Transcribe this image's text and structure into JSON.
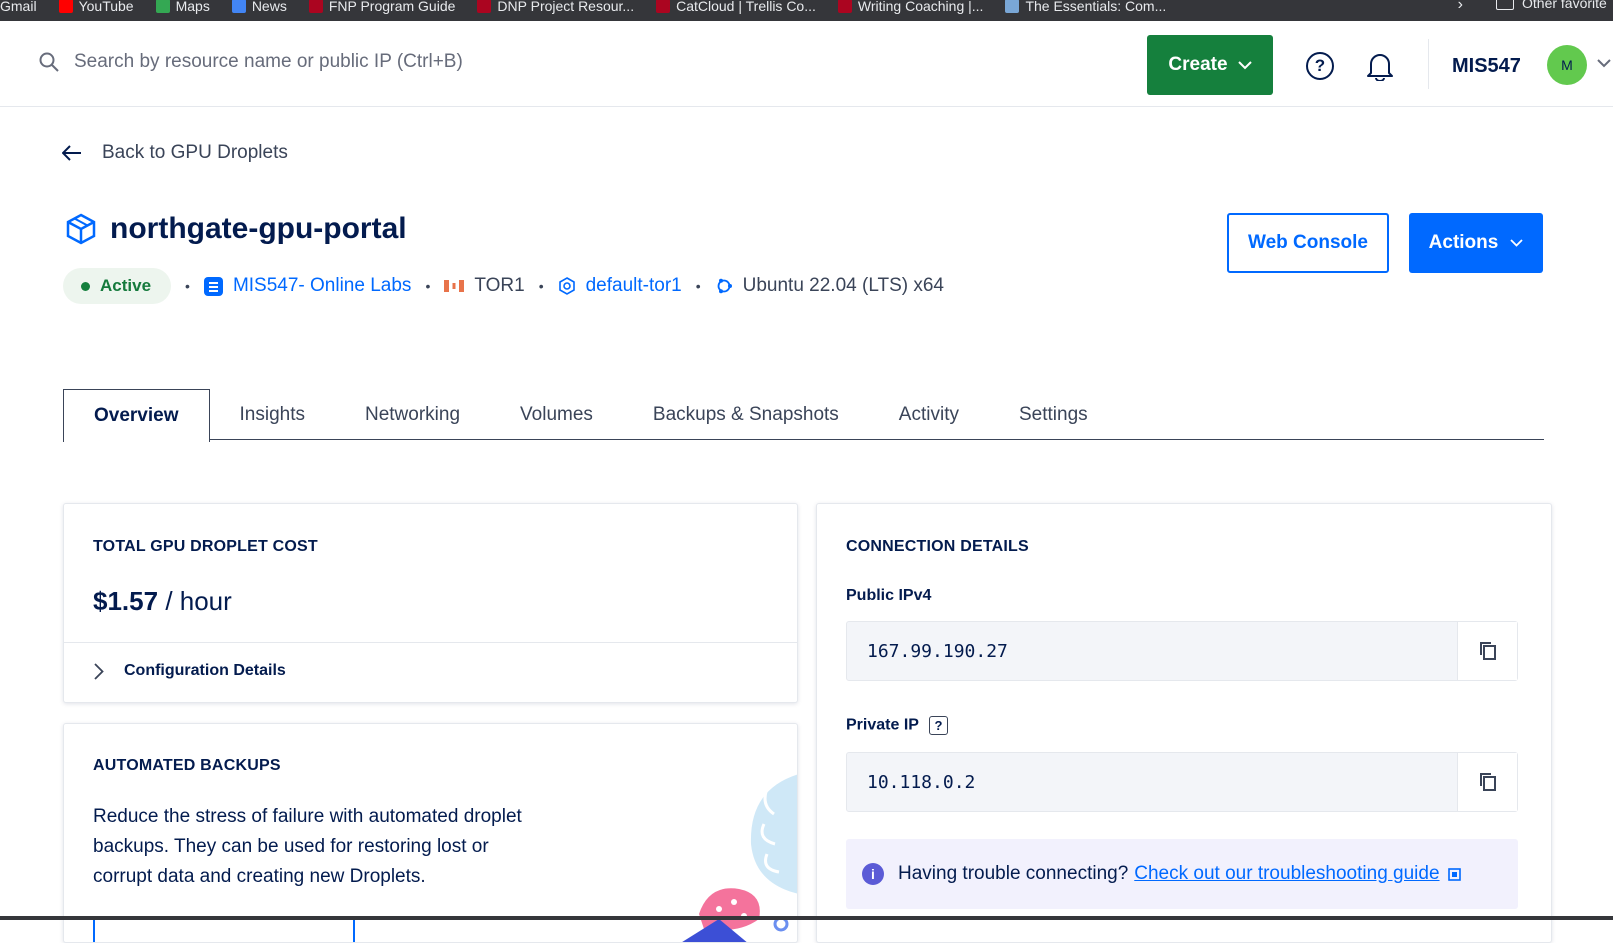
{
  "bookmarks": [
    {
      "label": "Gmail",
      "color": "#ea4335"
    },
    {
      "label": "YouTube",
      "color": "#ff0000"
    },
    {
      "label": "Maps",
      "color": "#34a853"
    },
    {
      "label": "News",
      "color": "#4285f4"
    },
    {
      "label": "FNP Program Guide",
      "color": "#ab0520"
    },
    {
      "label": "DNP Project Resour...",
      "color": "#ab0520"
    },
    {
      "label": "CatCloud | Trellis Co...",
      "color": "#ab0520"
    },
    {
      "label": "Writing Coaching |...",
      "color": "#ab0520"
    },
    {
      "label": "The Essentials: Com...",
      "color": "#7aa7d6"
    }
  ],
  "bookmarks_other": "Other favorite",
  "topbar": {
    "search_placeholder": "Search by resource name or public IP (Ctrl+B)",
    "create_label": "Create",
    "account_name": "MIS547",
    "avatar_initial": "M"
  },
  "back_link": "Back to GPU Droplets",
  "droplet": {
    "name": "northgate-gpu-portal",
    "status": "Active",
    "project": "MIS547- Online Labs",
    "region": "TOR1",
    "vpc": "default-tor1",
    "image": "Ubuntu 22.04 (LTS) x64"
  },
  "buttons": {
    "web_console": "Web Console",
    "actions": "Actions"
  },
  "tabs": [
    "Overview",
    "Insights",
    "Networking",
    "Volumes",
    "Backups & Snapshots",
    "Activity",
    "Settings"
  ],
  "cost_card": {
    "heading": "TOTAL GPU DROPLET COST",
    "price": "$1.57",
    "unit": "/ hour",
    "config_label": "Configuration Details"
  },
  "backups_card": {
    "heading": "AUTOMATED BACKUPS",
    "text": "Reduce the stress of failure with automated droplet backups. They can be used for restoring lost or corrupt data and creating new Droplets."
  },
  "connection_card": {
    "heading": "CONNECTION DETAILS",
    "public_label": "Public IPv4",
    "public_ip": "167.99.190.27",
    "private_label": "Private IP",
    "private_ip": "10.118.0.2",
    "trouble_text": "Having trouble connecting?",
    "trouble_link": "Check out our troubleshooting guide"
  },
  "colors": {
    "brand_blue": "#0069ff",
    "create_green": "#15803d",
    "status_green": "#15803d",
    "text_navy": "#031b4e"
  }
}
